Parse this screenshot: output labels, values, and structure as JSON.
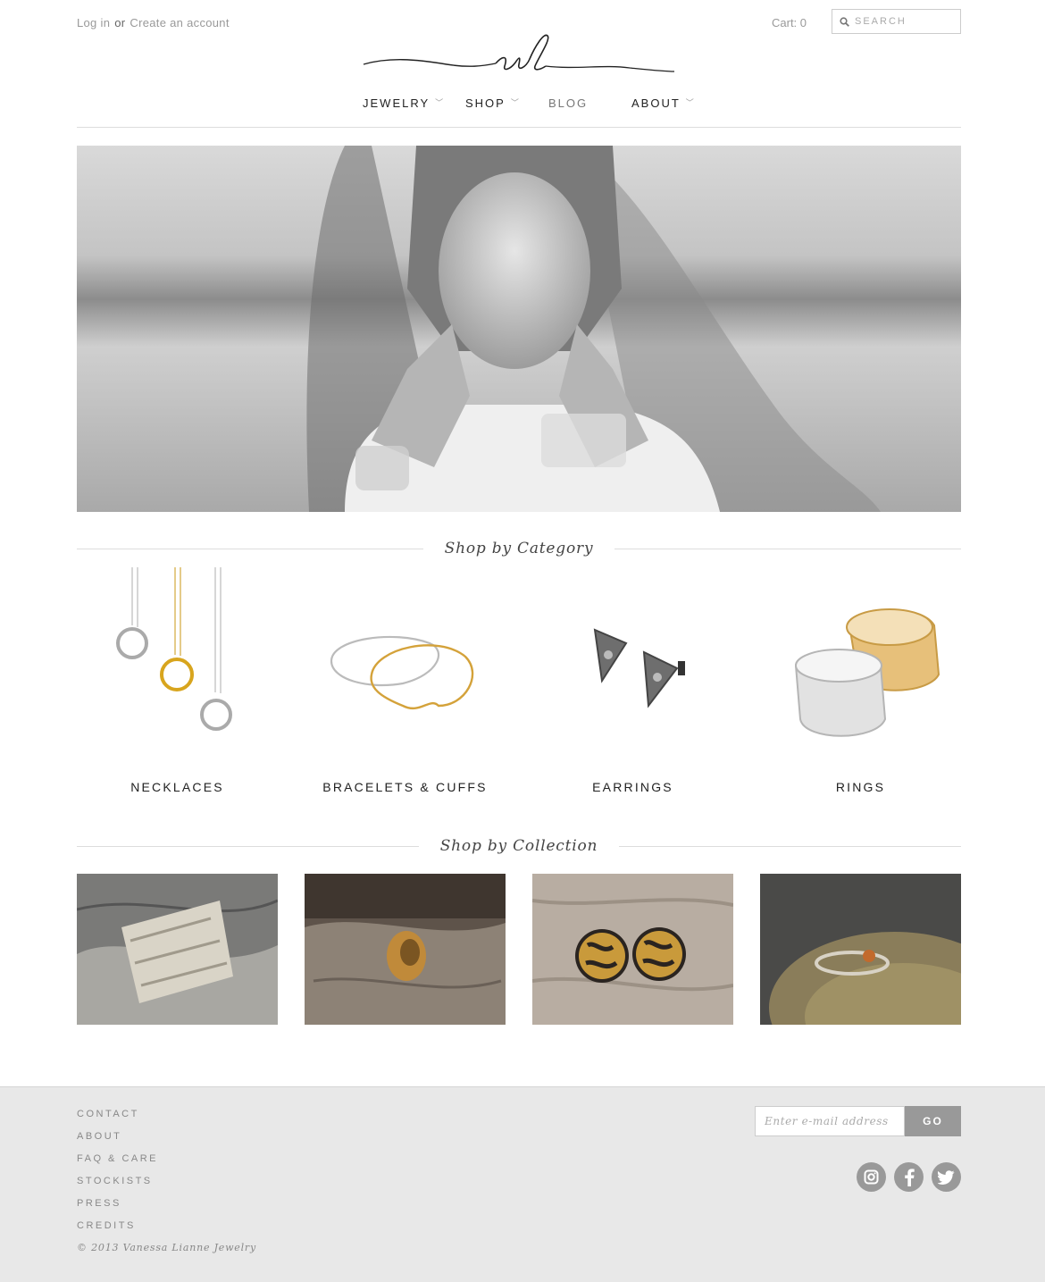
{
  "header": {
    "login_label": "Log in",
    "or_label": "or",
    "create_account_label": "Create an account",
    "cart_label": "Cart: 0",
    "search_placeholder": "SEARCH"
  },
  "nav": {
    "items": [
      {
        "label": "JEWELRY",
        "has_dropdown": true
      },
      {
        "label": "SHOP",
        "has_dropdown": true
      },
      {
        "label": "BLOG",
        "has_dropdown": false
      },
      {
        "label": "ABOUT",
        "has_dropdown": true
      }
    ],
    "chevron_glyph": "﹀"
  },
  "sections": {
    "category_title": "Shop by Category",
    "collection_title": "Shop by Collection"
  },
  "categories": [
    {
      "label": "NECKLACES",
      "icon": "necklaces-image"
    },
    {
      "label": "BRACELETS & CUFFS",
      "icon": "bracelets-image"
    },
    {
      "label": "EARRINGS",
      "icon": "earrings-image"
    },
    {
      "label": "RINGS",
      "icon": "rings-image"
    }
  ],
  "footer": {
    "links": [
      "CONTACT",
      "ABOUT",
      "FAQ & CARE",
      "STOCKISTS",
      "PRESS",
      "CREDITS"
    ],
    "copyright": "© 2013 Vanessa Lianne Jewelry",
    "email_placeholder": "Enter e-mail address",
    "go_label": "GO",
    "social": [
      "instagram-icon",
      "facebook-icon",
      "twitter-icon"
    ]
  },
  "colors": {
    "footer_bg": "#e8e8e8",
    "button_gray": "#999999",
    "rule": "#dddddd"
  }
}
